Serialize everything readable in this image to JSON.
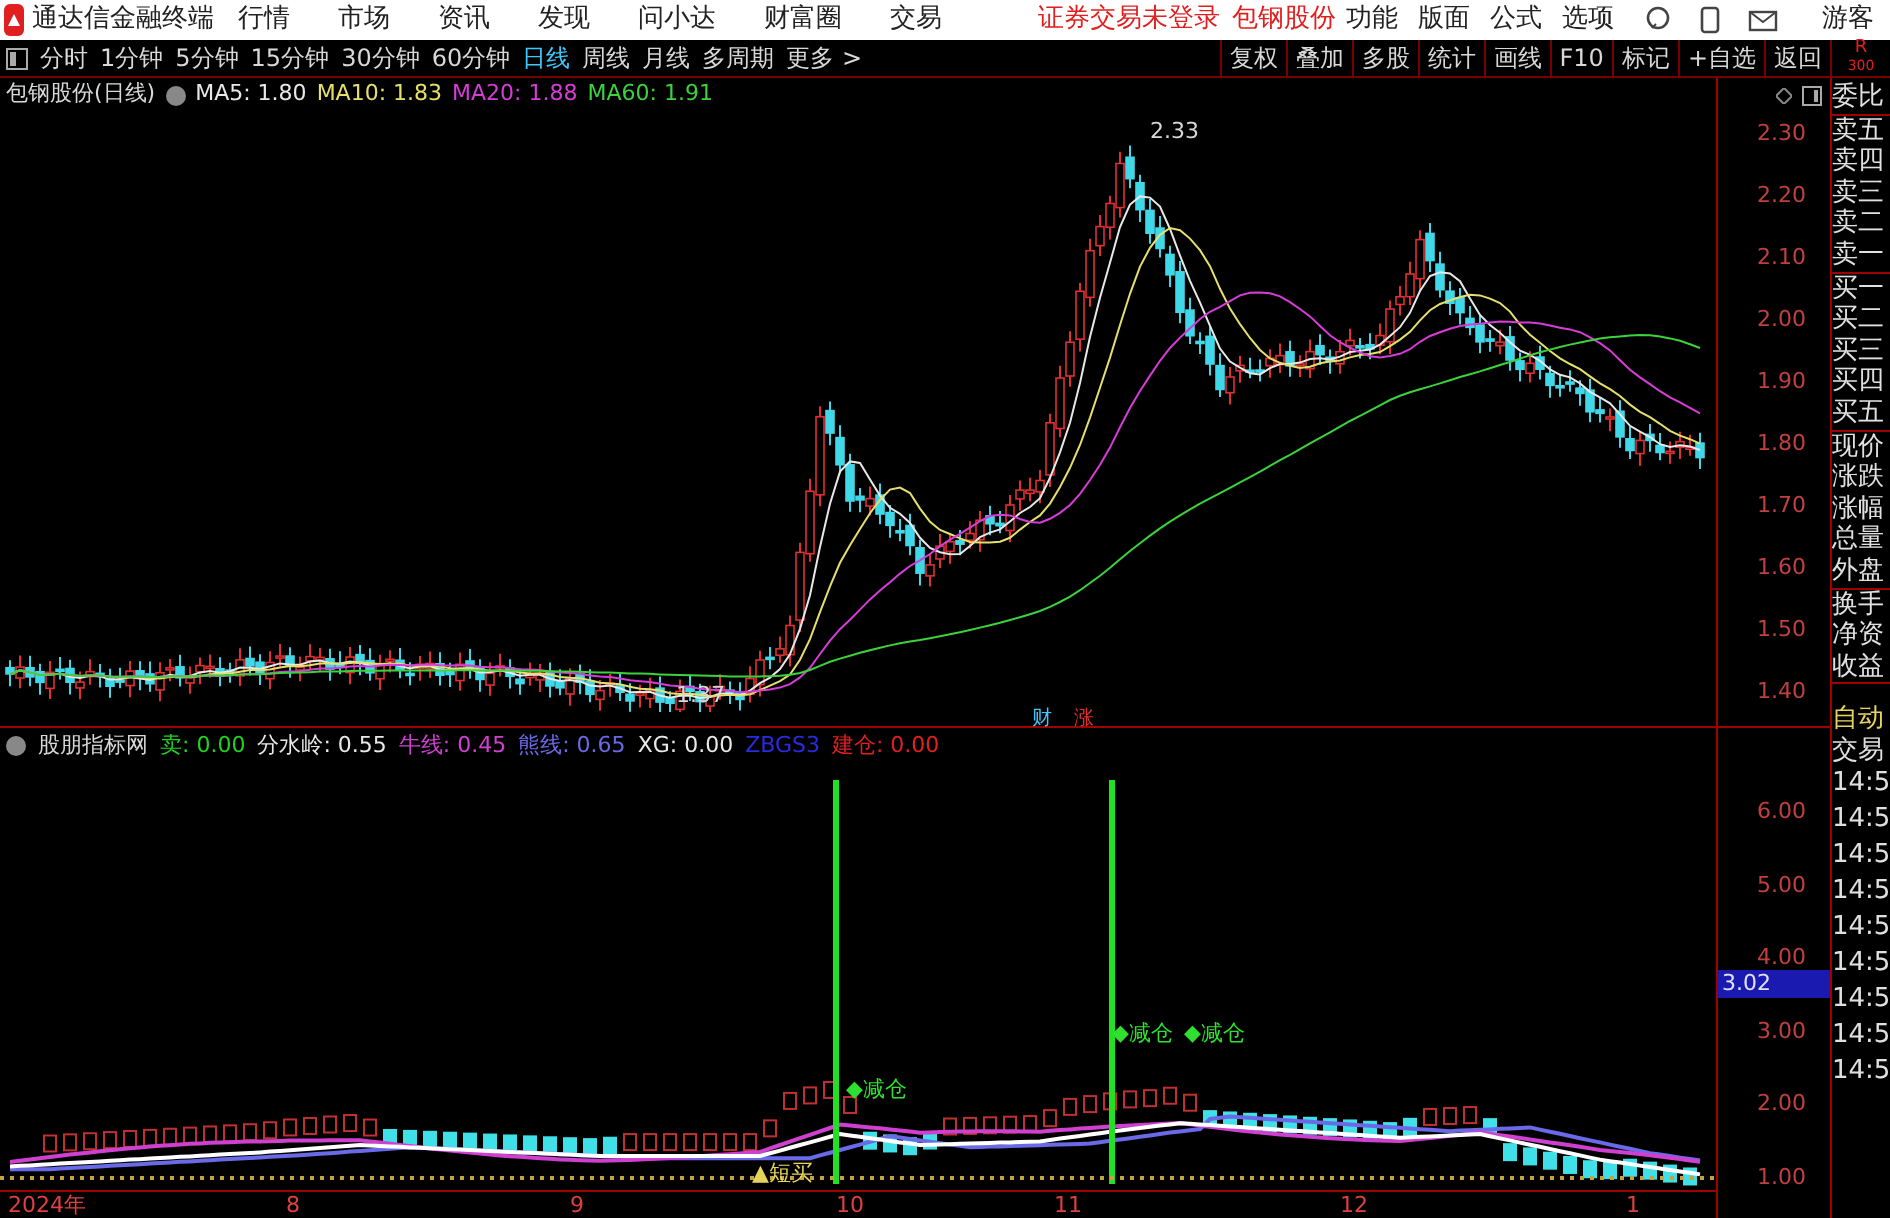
{
  "menu_bar": {
    "app_title": "通达信金融终端",
    "items": [
      "行情",
      "市场",
      "资讯",
      "发现",
      "问小达",
      "财富圈",
      "交易"
    ],
    "notice": "证券交易未登录",
    "stock": "包钢股份",
    "right_items": [
      "功能",
      "版面",
      "公式",
      "选项"
    ],
    "user": "游客"
  },
  "period_bar": {
    "periods": [
      {
        "label": "分时",
        "selected": false
      },
      {
        "label": "1分钟",
        "selected": false
      },
      {
        "label": "5分钟",
        "selected": false
      },
      {
        "label": "15分钟",
        "selected": false
      },
      {
        "label": "30分钟",
        "selected": false
      },
      {
        "label": "60分钟",
        "selected": false
      },
      {
        "label": "日线",
        "selected": true
      },
      {
        "label": "周线",
        "selected": false
      },
      {
        "label": "月线",
        "selected": false
      },
      {
        "label": "多周期",
        "selected": false
      },
      {
        "label": "更多 >",
        "selected": false
      }
    ],
    "tools": [
      "复权",
      "叠加",
      "多股",
      "统计",
      "画线",
      "F10",
      "标记",
      "+自选",
      "返回"
    ],
    "corner": [
      "R",
      "300"
    ]
  },
  "price_chart": {
    "title": "包钢股份(日线)",
    "averages": [
      {
        "label": "MA5: 1.80",
        "color": "#e8e8e8"
      },
      {
        "label": "MA10: 1.83",
        "color": "#e6e06a"
      },
      {
        "label": "MA20: 1.88",
        "color": "#d83cd8"
      },
      {
        "label": "MA60: 1.91",
        "color": "#3cd23c"
      }
    ],
    "axis": [
      "2.30",
      "2.20",
      "2.10",
      "2.00",
      "1.90",
      "1.80",
      "1.70",
      "1.60",
      "1.50",
      "1.40"
    ],
    "high_label": "2.33",
    "low_label": "1.37",
    "markers": [
      "财",
      "涨"
    ]
  },
  "indicator": {
    "title": "股朋指标网",
    "values": [
      {
        "label": "卖: 0.00",
        "color": "#22d022"
      },
      {
        "label": "分水岭: 0.55",
        "color": "#e8e8e8"
      },
      {
        "label": "牛线: 0.45",
        "color": "#d040d0"
      },
      {
        "label": "熊线: 0.65",
        "color": "#6a6ae8"
      },
      {
        "label": "XG: 0.00",
        "color": "#e8e8e8"
      },
      {
        "label": "ZBGS3",
        "color": "#2a2ae0"
      },
      {
        "label": "建仓: 0.00",
        "color": "#e02020"
      }
    ],
    "axis": [
      "6.00",
      "5.00",
      "4.00",
      "3.00",
      "2.00",
      "1.00"
    ],
    "current": "3.02",
    "signals": [
      "◆减仓",
      "◆减仓",
      "◆减仓",
      "▲短买"
    ]
  },
  "date_axis": [
    "2024年",
    "8",
    "9",
    "10",
    "11",
    "12",
    "1"
  ],
  "quote_panel": {
    "groups": [
      [
        "委比"
      ],
      [
        "卖五",
        "卖四",
        "卖三",
        "卖二",
        "卖一"
      ],
      [
        "买一",
        "买二",
        "买三",
        "买四",
        "买五"
      ],
      [
        "现价",
        "涨跌",
        "涨幅",
        "总量",
        "外盘"
      ],
      [
        "换手",
        "净资",
        "收益"
      ]
    ],
    "mode": "自动",
    "trade": "交易",
    "times": [
      "14:5",
      "14:5",
      "14:5",
      "14:5",
      "14:5",
      "14:5",
      "14:5",
      "14:5",
      "14:5"
    ]
  }
}
